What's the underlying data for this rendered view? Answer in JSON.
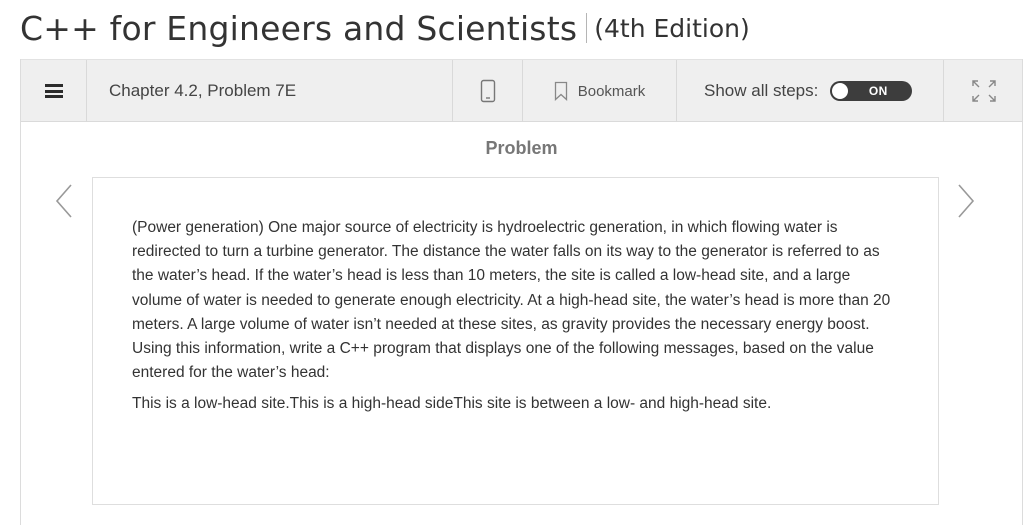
{
  "book": {
    "title": "C++ for Engineers and Scientists",
    "edition": "(4th Edition)"
  },
  "toolbar": {
    "chapter": "Chapter 4.2, Problem 7E",
    "bookmark_label": "Bookmark",
    "show_steps_label": "Show all steps:",
    "toggle_label": "ON"
  },
  "problem": {
    "heading": "Problem",
    "text": "(Power generation) One major source of electricity is hydroelectric generation, in which flowing water is redirected to turn a turbine generator. The distance the water falls on its way to the generator is referred to as the water’s head. If the water’s head is less than 10 meters, the site is called a low-head site, and a large volume of water is needed to generate enough electricity. At a high-head site, the water’s head is more than 20 meters. A large volume of water isn’t needed at these sites, as gravity provides the necessary energy boost. Using this information, write a C++ program that displays one of the following messages, based on the value entered for the water’s head:",
    "messages": "This is a low-head site.This is a high-head sideThis site is between a low- and high-head site."
  },
  "icons": {
    "menu": "list-menu-icon",
    "device": "mobile-device-icon",
    "bookmark": "bookmark-icon",
    "expand": "fullscreen-expand-icon",
    "prev": "chevron-left-icon",
    "next": "chevron-right-icon"
  }
}
